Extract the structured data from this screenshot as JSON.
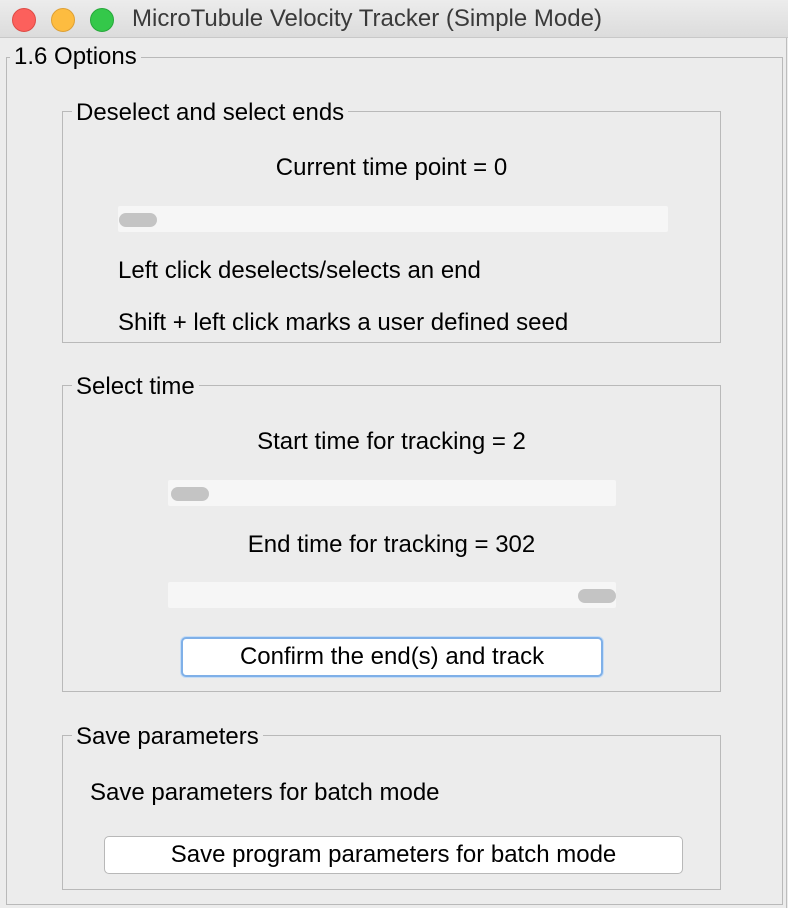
{
  "window": {
    "title": "MicroTubule Velocity Tracker (Simple Mode)"
  },
  "options": {
    "label": "1.6 Options"
  },
  "ends_panel": {
    "label": "Deselect and select ends",
    "current_time": "Current time point = 0",
    "current_slider_value": 0,
    "instruction_1": "Left click deselects/selects an end",
    "instruction_2": "Shift +  left click marks a user defined seed"
  },
  "time_panel": {
    "label": "Select time",
    "start_text": "Start time for tracking = 2",
    "start_value": 2,
    "end_text": "End time for tracking  = 302",
    "end_value": 302,
    "confirm_button": "Confirm the end(s) and track"
  },
  "save_panel": {
    "label": "Save parameters",
    "description": "Save parameters for batch mode",
    "save_button": "Save program parameters for batch mode"
  }
}
